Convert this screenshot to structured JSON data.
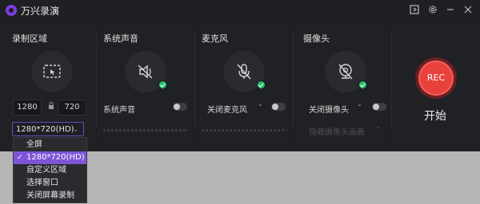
{
  "app": {
    "title": "万兴录演"
  },
  "sections": {
    "region": {
      "title": "录制区域",
      "width": "1280",
      "height": "720",
      "resolution": "1280*720(HD)"
    },
    "system_audio": {
      "title": "系统声音",
      "label": "系统声音"
    },
    "microphone": {
      "title": "麦克风",
      "select": "关闭麦克风"
    },
    "camera": {
      "title": "摄像头",
      "select": "关闭摄像头",
      "sub_select": "隐藏摄像头画面"
    }
  },
  "record": {
    "button": "REC",
    "start_label": "开始",
    "color": "#e8413c"
  },
  "dropdown": {
    "items": [
      "全屏",
      "1280*720(HD)",
      "自定义区域",
      "选择窗口",
      "关闭屏幕录制"
    ],
    "selected_index": 1,
    "check_mark": "✓"
  },
  "status_color": "#22c16b",
  "accent": "#7e55d8"
}
